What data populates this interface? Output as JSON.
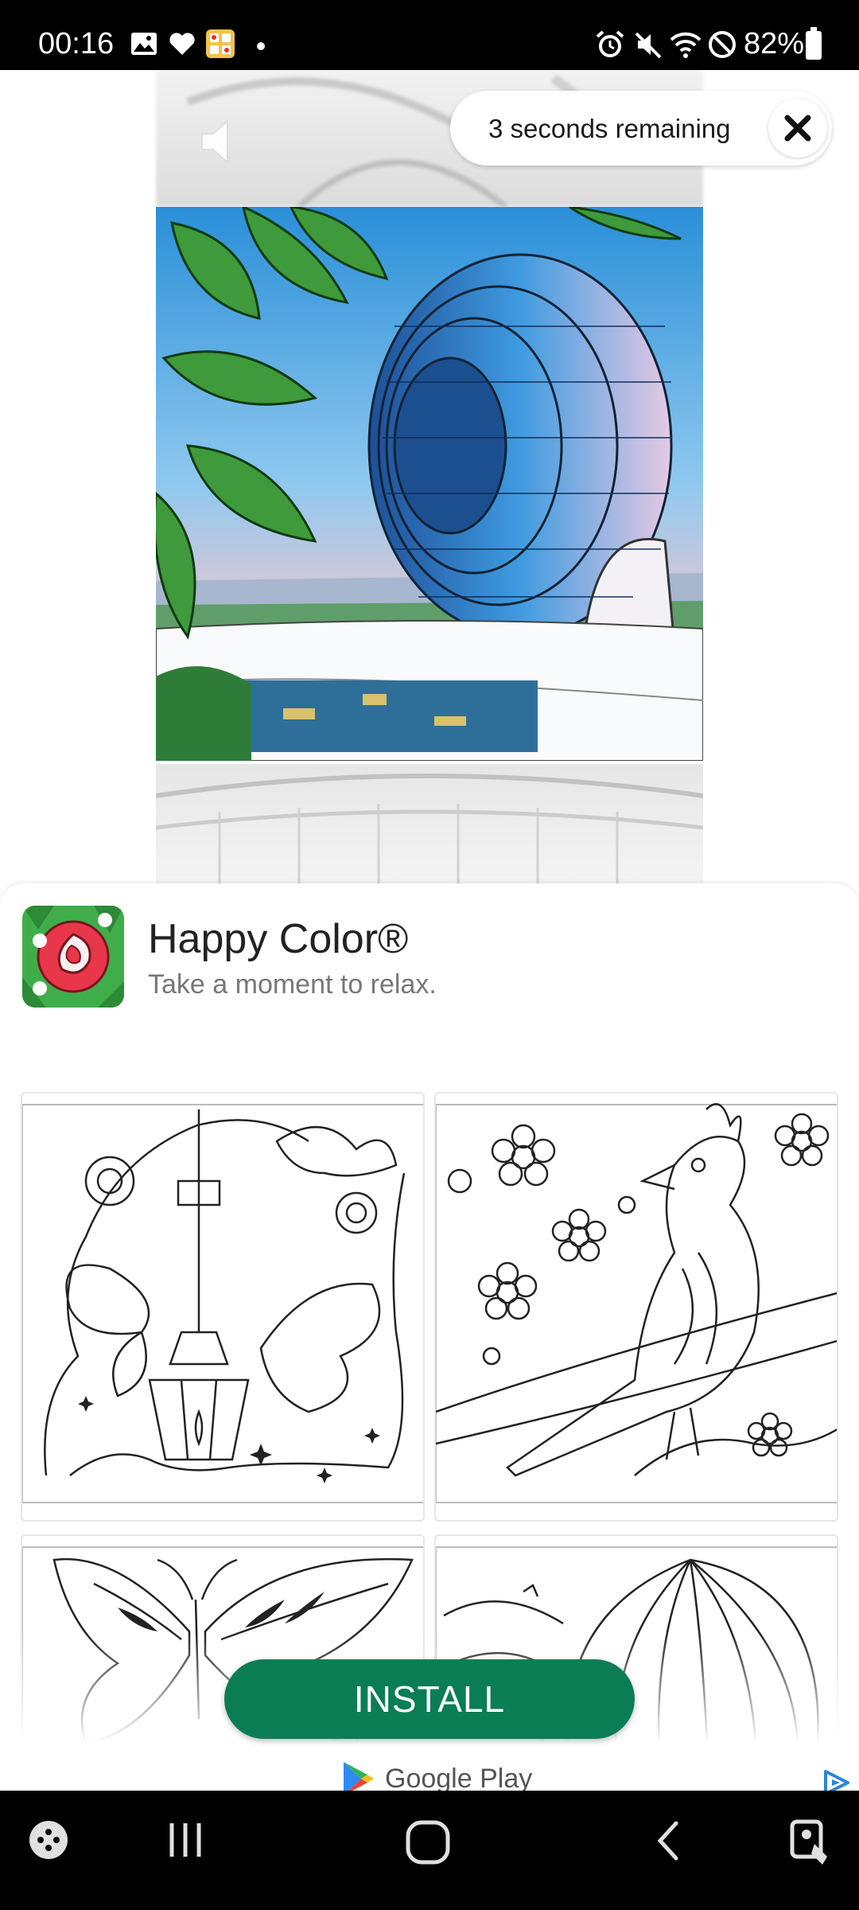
{
  "status_bar": {
    "time": "00:16",
    "battery": "82%",
    "icons": [
      "gallery-icon",
      "heart-icon",
      "game-icon",
      "dot-icon",
      "alarm-icon",
      "mute-icon",
      "wifi-icon",
      "dnd-icon",
      "battery-icon"
    ]
  },
  "ad": {
    "timer_text": "3 seconds remaining",
    "close_icon": "close-icon",
    "mute_icon": "speaker-icon"
  },
  "app": {
    "name": "Happy Color®",
    "tagline": "Take a moment to relax.",
    "install_label": "INSTALL",
    "store_label": "Google Play",
    "accent_color": "#0b7d55"
  },
  "gallery": {
    "tiles": [
      "lantern-butterflies-artwork",
      "bird-blossoms-artwork",
      "butterfly-artwork",
      "hot-air-balloon-artwork"
    ]
  },
  "nav_bar": {
    "items": [
      "game-launcher-icon",
      "recents-icon",
      "home-icon",
      "back-icon",
      "accessibility-icon"
    ]
  }
}
